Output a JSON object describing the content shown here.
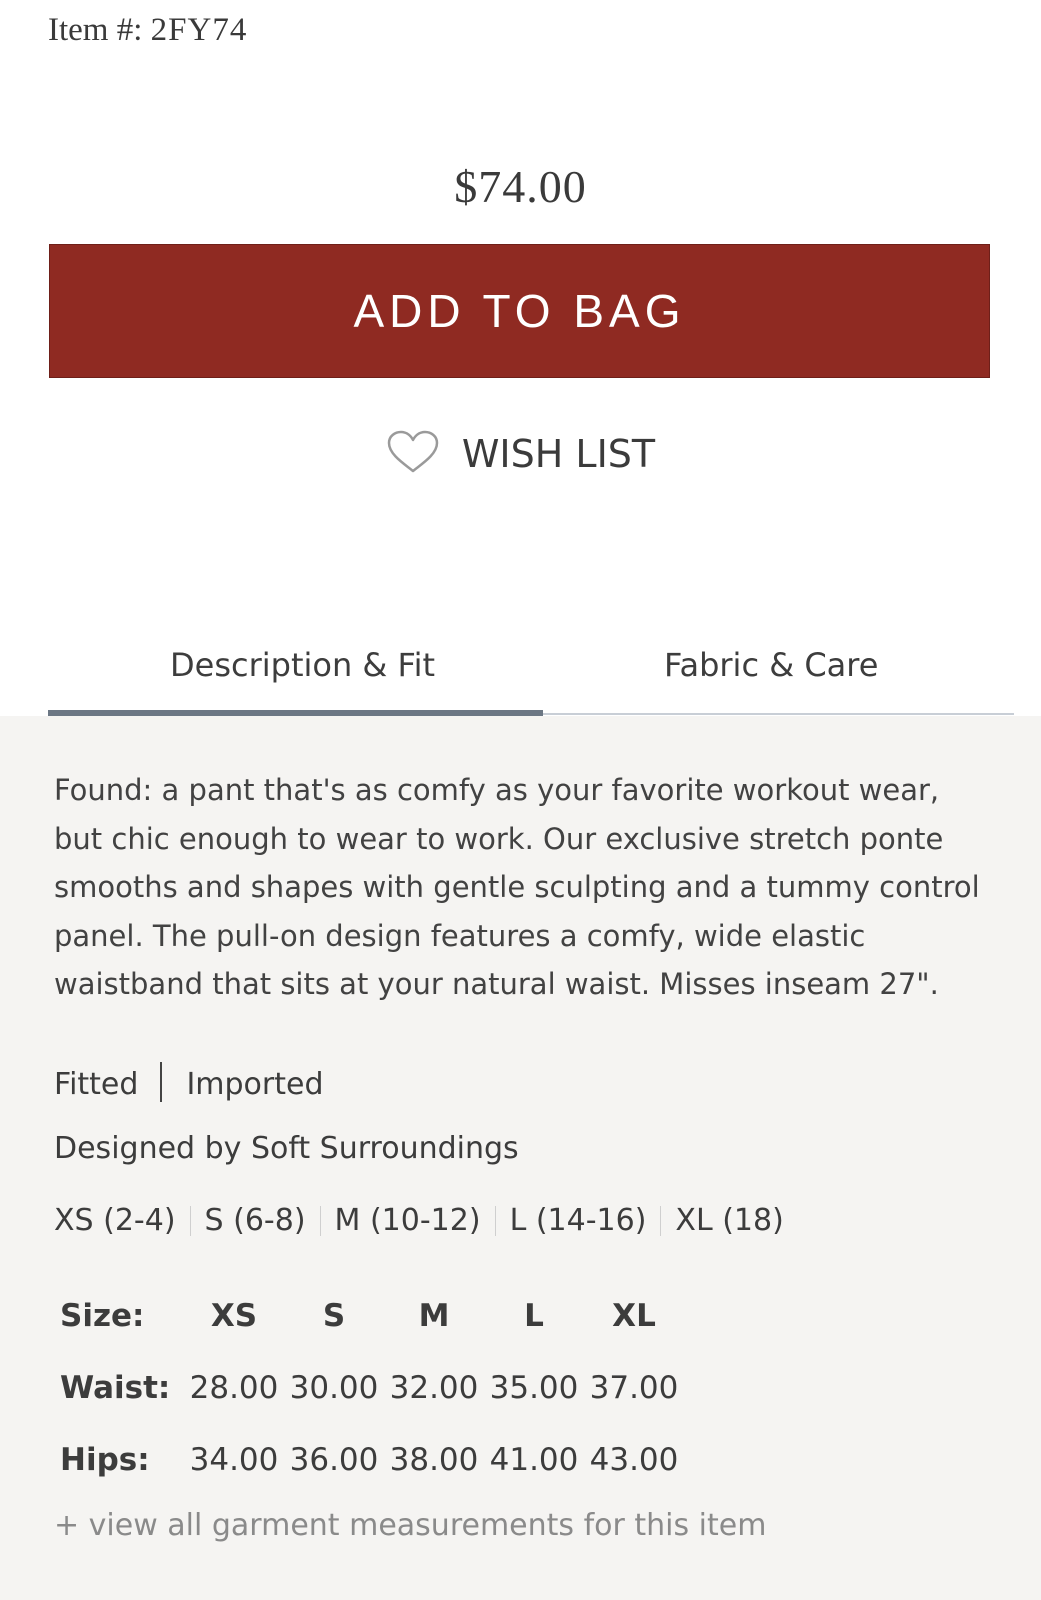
{
  "item": {
    "label": "Item #:",
    "number": "2FY74"
  },
  "price": "$74.00",
  "actions": {
    "add_to_bag": "ADD TO BAG",
    "wish_list": "WISH LIST"
  },
  "tabs": [
    {
      "label": "Description & Fit",
      "active": true
    },
    {
      "label": "Fabric & Care",
      "active": false
    }
  ],
  "description": "Found: a pant that's as comfy as your favorite workout wear, but chic enough to wear to work. Our exclusive stretch ponte smooths and shapes with gentle sculpting and a tummy control panel. The pull-on design features a comfy, wide elastic waistband that sits at your natural waist. Misses inseam 27\".",
  "attributes": {
    "fit": "Fitted",
    "origin": "Imported",
    "designer": "Designed by Soft Surroundings"
  },
  "size_ranges": [
    "XS (2-4)",
    "S (6-8)",
    "M (10-12)",
    "L (14-16)",
    "XL (18)"
  ],
  "size_chart": {
    "size_label": "Size:",
    "sizes": [
      "XS",
      "S",
      "M",
      "L",
      "XL"
    ],
    "rows": [
      {
        "label": "Waist:",
        "values": [
          "28.00",
          "30.00",
          "32.00",
          "35.00",
          "37.00"
        ]
      },
      {
        "label": "Hips:",
        "values": [
          "34.00",
          "36.00",
          "38.00",
          "41.00",
          "43.00"
        ]
      }
    ]
  },
  "view_all_link": "+ view all garment measurements for this item",
  "colors": {
    "accent": "#8f2a22",
    "tab_active": "#6c7784",
    "panel_bg": "#f5f4f2"
  },
  "icons": {
    "wish_list": "heart-outline-icon"
  }
}
